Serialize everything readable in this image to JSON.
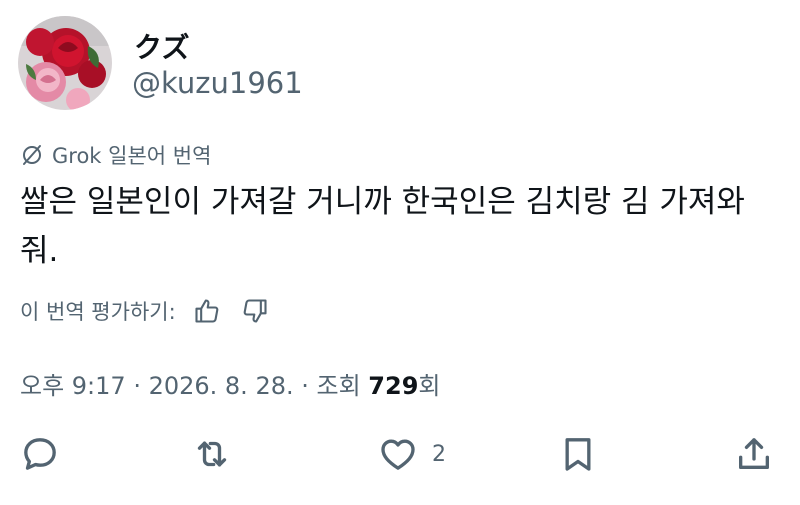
{
  "author": {
    "display_name": "クズ",
    "handle": "@kuzu1961",
    "avatar_icon": "rose-avatar"
  },
  "translation": {
    "label": "Grok 일본어 번역",
    "icon": "grok-icon"
  },
  "tweet": {
    "text": "쌀은 일본인이 가져갈 거니까 한국인은 김치랑 김 가져와 줘."
  },
  "rating": {
    "prompt": "이 번역 평가하기:",
    "like_icon": "thumbs-up-icon",
    "dislike_icon": "thumbs-down-icon"
  },
  "meta": {
    "time": "오후 9:17",
    "separator": " · ",
    "date": "2026. 8. 28.",
    "views_label": "조회 ",
    "views_count": "729",
    "views_suffix": "회"
  },
  "actions": {
    "reply_icon": "reply-icon",
    "retweet_icon": "retweet-icon",
    "like_icon": "heart-icon",
    "like_count": "2",
    "bookmark_icon": "bookmark-icon",
    "share_icon": "share-icon"
  },
  "colors": {
    "text": "#0f1419",
    "secondary": "#536471",
    "rose_red": "#c8102e",
    "rose_pink": "#e88aa8"
  }
}
